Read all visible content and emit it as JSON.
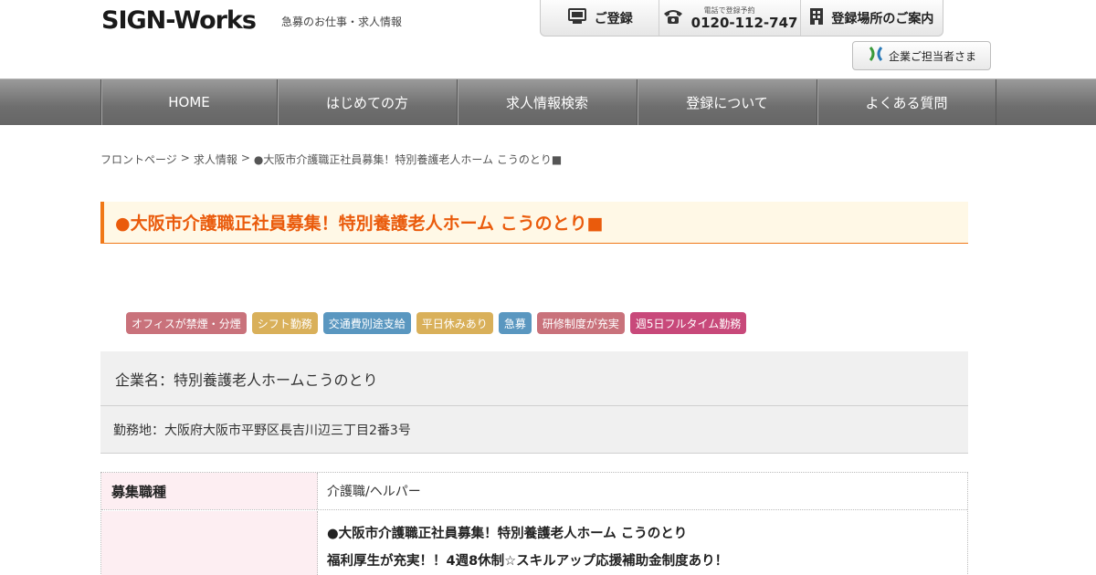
{
  "header": {
    "logo_text": "SIGN-Works",
    "tagline": "急募のお仕事・求人情報",
    "register_label": "ご登録",
    "phone_caption": "電話で登録予約",
    "phone_number": "0120-112-747",
    "locations_label": "登録場所のご案内",
    "corporate_label": "企業ご担当者さま"
  },
  "nav": {
    "items": [
      {
        "label": "HOME"
      },
      {
        "label": "はじめての方"
      },
      {
        "label": "求人情報検索"
      },
      {
        "label": "登録について"
      },
      {
        "label": "よくある質問"
      }
    ]
  },
  "breadcrumb": {
    "items": [
      "フロントページ",
      "求人情報",
      "●大阪市介護職正社員募集！特別養護老人ホーム こうのとり■"
    ],
    "separator": ">"
  },
  "page_title": "●大阪市介護職正社員募集！特別養護老人ホーム こうのとり■",
  "tags": [
    {
      "label": "オフィスが禁煙・分煙",
      "color": "#c9727b"
    },
    {
      "label": "シフト勤務",
      "color": "#d9b05a"
    },
    {
      "label": "交通費別途支給",
      "color": "#5a97c0"
    },
    {
      "label": "平日休みあり",
      "color": "#d9b05a"
    },
    {
      "label": "急募",
      "color": "#5a97c0"
    },
    {
      "label": "研修制度が充実",
      "color": "#c9727b"
    },
    {
      "label": "週5日フルタイム勤務",
      "color": "#c8497a"
    }
  ],
  "company": {
    "name": "企業名：特別養護老人ホームこうのとり",
    "address": "勤務地：大阪府大阪市平野区長吉川辺三丁目2番3号"
  },
  "details": {
    "job_type_label": "募集職種",
    "job_type_value": "介護職/ヘルパー",
    "desc_line1": "●大阪市介護職正社員募集！特別養護老人ホーム こうのとり",
    "desc_line2": "福利厚生が充実！！4週8休制☆スキルアップ応援補助金制度あり！"
  },
  "colors": {
    "accent": "#ea5b0c",
    "title_bg": "#fff8e6",
    "nav_bg": "#767676",
    "table_header_bg": "#fdeef2"
  }
}
